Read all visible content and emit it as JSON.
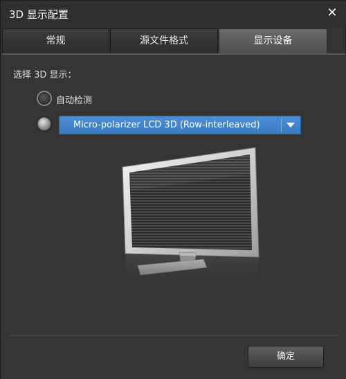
{
  "window": {
    "title": "3D 显示配置",
    "close_label": "✕"
  },
  "tabs": [
    {
      "label": "常规"
    },
    {
      "label": "源文件格式"
    },
    {
      "label": "显示设备"
    }
  ],
  "active_tab": "显示设备",
  "display": {
    "select_label": "选择 3D 显示：",
    "auto_detect_label": "自动检测",
    "device_selected": "Micro-polarizer LCD 3D (Row-interleaved)"
  },
  "footer": {
    "ok_label": "确定"
  }
}
